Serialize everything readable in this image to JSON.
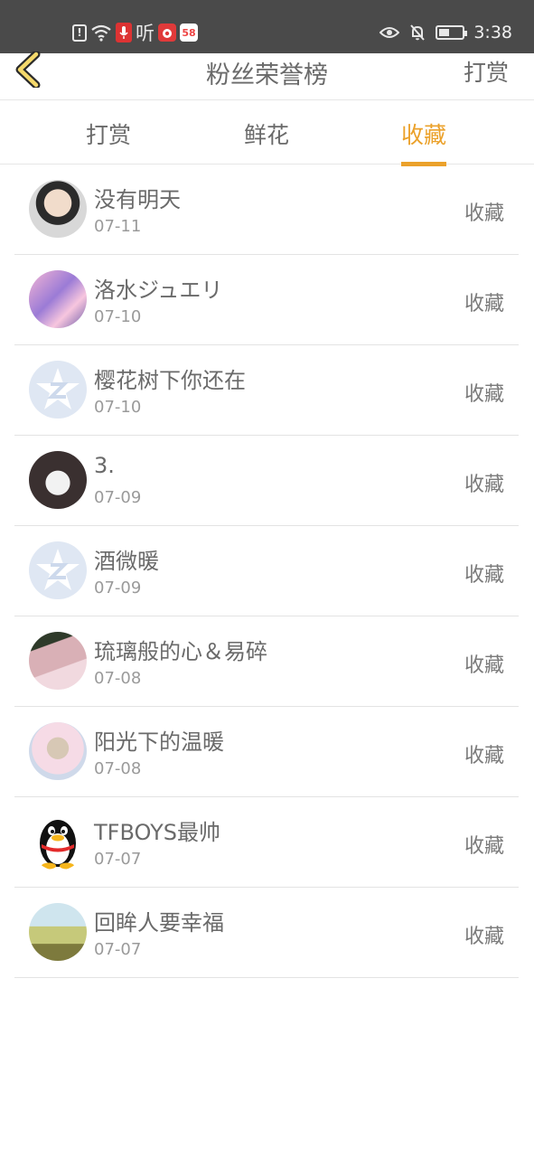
{
  "status_bar": {
    "time": "3:38",
    "battery_level": 0.45,
    "left_icons": [
      "sim-alert-icon",
      "wifi-icon",
      "mic-app-icon",
      "ting-app-icon",
      "weibo-app-icon",
      "58-app-icon"
    ],
    "ting_label": "听",
    "app_58_label": "58",
    "right_icons": [
      "eye-comfort-icon",
      "bell-off-icon",
      "battery-icon"
    ]
  },
  "header": {
    "title": "粉丝荣誉榜",
    "action_label": "打赏"
  },
  "tabs": [
    {
      "label": "打赏",
      "active": false
    },
    {
      "label": "鲜花",
      "active": false
    },
    {
      "label": "收藏",
      "active": true
    }
  ],
  "colors": {
    "accent": "#eba12a",
    "status_bar_bg": "#4a4a4a",
    "text": "#6a6a6a",
    "date_text": "#9a9a9a",
    "divider": "#e3e3e3"
  },
  "list": [
    {
      "name": "没有明天",
      "date": "07-11",
      "action": "收藏"
    },
    {
      "name": "洛水ジュエリ",
      "date": "07-10",
      "action": "收藏"
    },
    {
      "name": "樱花树下你还在",
      "date": "07-10",
      "action": "收藏"
    },
    {
      "name": "3.",
      "date": "07-09",
      "action": "收藏"
    },
    {
      "name": "酒微暖",
      "date": "07-09",
      "action": "收藏"
    },
    {
      "name": "琉璃般的心＆易碎",
      "date": "07-08",
      "action": "收藏"
    },
    {
      "name": "阳光下的温暖",
      "date": "07-08",
      "action": "收藏"
    },
    {
      "name": "TFBOYS最帅",
      "date": "07-07",
      "action": "收藏"
    },
    {
      "name": "回眸人要幸福",
      "date": "07-07",
      "action": "收藏"
    }
  ]
}
